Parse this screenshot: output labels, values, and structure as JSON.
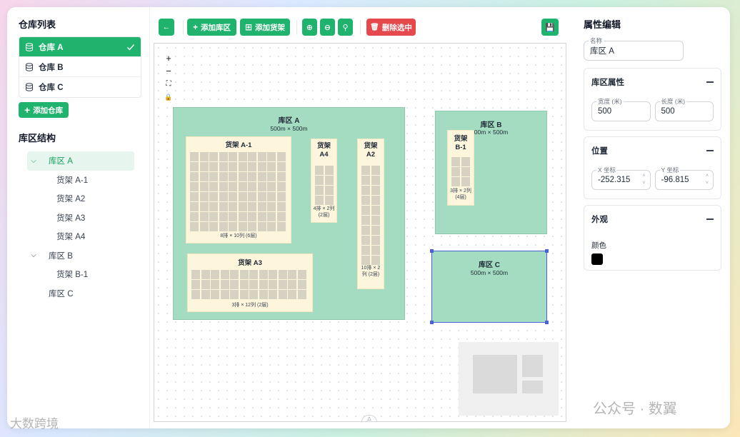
{
  "left": {
    "warehouse_title": "仓库列表",
    "warehouses": [
      {
        "label": "仓库 A",
        "active": true
      },
      {
        "label": "仓库 B",
        "active": false
      },
      {
        "label": "仓库 C",
        "active": false
      }
    ],
    "add_warehouse": "添加仓库",
    "structure_title": "库区结构",
    "tree": [
      {
        "label": "库区 A",
        "level": 0,
        "expanded": true,
        "selected": true
      },
      {
        "label": "货架 A-1",
        "level": 1
      },
      {
        "label": "货架 A2",
        "level": 1
      },
      {
        "label": "货架 A3",
        "level": 1
      },
      {
        "label": "货架 A4",
        "level": 1
      },
      {
        "label": "库区 B",
        "level": 0,
        "expanded": true
      },
      {
        "label": "货架 B-1",
        "level": 1
      },
      {
        "label": "库区 C",
        "level": 0,
        "leaf": true
      }
    ]
  },
  "toolbar": {
    "add_zone": "添加库区",
    "add_shelf": "添加货架",
    "delete_selected": "删除选中"
  },
  "canvas": {
    "zoom_in": "+",
    "zoom_out": "−",
    "zones": [
      {
        "title": "库区 A",
        "sub": "500m × 500m"
      },
      {
        "title": "库区 B",
        "sub": "00m × 500m"
      },
      {
        "title": "库区 C",
        "sub": "500m × 500m"
      }
    ],
    "shelves": [
      {
        "title": "货架 A-1",
        "sub": "8排 × 10列 (6层)"
      },
      {
        "title": "货架 A4",
        "sub": "4排 × 2列 (2层)"
      },
      {
        "title": "货架 A2",
        "sub": "10排 × 2列 (2层)"
      },
      {
        "title": "货架 A3",
        "sub": "3排 × 12列 (2层)"
      },
      {
        "title": "货架 B-1",
        "sub": "3排 × 2列 (4层)"
      }
    ]
  },
  "right": {
    "title": "属性编辑",
    "name_label": "名称",
    "name_value": "库区 A",
    "zone_props": "库区属性",
    "width_label": "宽度 (米)",
    "width_value": "500",
    "length_label": "长度 (米)",
    "length_value": "500",
    "position": "位置",
    "x_label": "X 坐标",
    "x_value": "-252.315",
    "y_label": "Y 坐标",
    "y_value": "-96.815",
    "appearance": "外观",
    "color_label": "颜色",
    "color_value": "#000000"
  },
  "watermarks": {
    "left": "大数跨境",
    "right": "公众号 · 数翼"
  }
}
